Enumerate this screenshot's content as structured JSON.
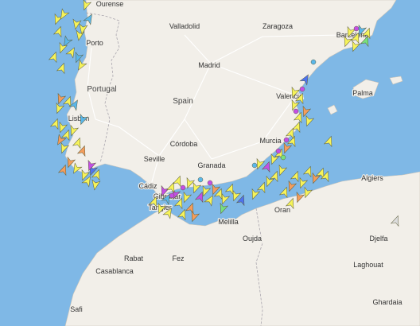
{
  "map": {
    "colors": {
      "sea": "#7fb8e6",
      "land": "#f2efe9",
      "cargo": "#f6f35a",
      "tanker": "#f49d5c",
      "passenger": "#4e73ef",
      "tug": "#5ab7ea",
      "fishing": "#c44ee6",
      "pleasure": "#78e07e"
    },
    "countries": [
      {
        "key": "portugal",
        "label": "Portugal"
      },
      {
        "key": "spain",
        "label": "Spain"
      }
    ],
    "cities": [
      {
        "key": "ourense",
        "label": "Ourense"
      },
      {
        "key": "valladolid",
        "label": "Valladolid"
      },
      {
        "key": "zaragoza",
        "label": "Zaragoza"
      },
      {
        "key": "barcelona",
        "label": "Barcelona"
      },
      {
        "key": "porto",
        "label": "Porto"
      },
      {
        "key": "madrid",
        "label": "Madrid"
      },
      {
        "key": "valencia",
        "label": "Valencia"
      },
      {
        "key": "palma",
        "label": "Palma"
      },
      {
        "key": "lisbon",
        "label": "Lisbon"
      },
      {
        "key": "cordoba",
        "label": "Córdoba"
      },
      {
        "key": "murcia",
        "label": "Murcia"
      },
      {
        "key": "seville",
        "label": "Seville"
      },
      {
        "key": "granada",
        "label": "Granada"
      },
      {
        "key": "algiers",
        "label": "Algiers"
      },
      {
        "key": "cadiz",
        "label": "Cádiz"
      },
      {
        "key": "gibraltar",
        "label": "Gibraltar"
      },
      {
        "key": "tangier",
        "label": "Tangier"
      },
      {
        "key": "oran",
        "label": "Oran"
      },
      {
        "key": "melilla",
        "label": "Melilla"
      },
      {
        "key": "oujda",
        "label": "Oujda"
      },
      {
        "key": "djelfa",
        "label": "Djelfa"
      },
      {
        "key": "rabat",
        "label": "Rabat"
      },
      {
        "key": "fez",
        "label": "Fez"
      },
      {
        "key": "laghouat",
        "label": "Laghouat"
      },
      {
        "key": "casablanca",
        "label": "Casablanca"
      },
      {
        "key": "ghardaia",
        "label": "Ghardaia"
      },
      {
        "key": "safi",
        "label": "Safi"
      }
    ]
  }
}
